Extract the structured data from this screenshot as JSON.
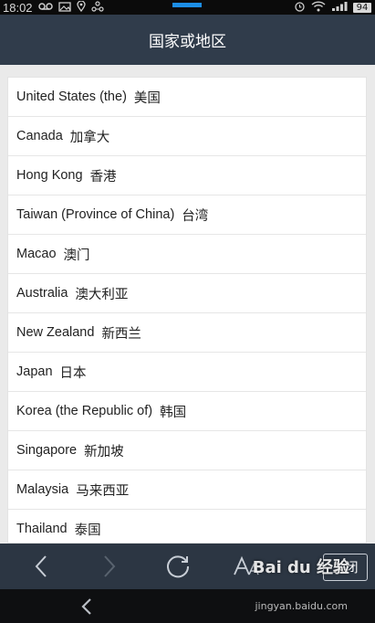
{
  "status_bar": {
    "time": "18:02",
    "battery": "94"
  },
  "title": "国家或地区",
  "countries": [
    {
      "en": "United States (the)",
      "cn": "美国"
    },
    {
      "en": "Canada",
      "cn": "加拿大"
    },
    {
      "en": "Hong Kong",
      "cn": "香港"
    },
    {
      "en": "Taiwan (Province of China)",
      "cn": "台湾"
    },
    {
      "en": "Macao",
      "cn": "澳门"
    },
    {
      "en": "Australia",
      "cn": "澳大利亚"
    },
    {
      "en": "New Zealand",
      "cn": "新西兰"
    },
    {
      "en": "Japan",
      "cn": "日本"
    },
    {
      "en": "Korea (the Republic of)",
      "cn": "韩国"
    },
    {
      "en": "Singapore",
      "cn": "新加坡"
    },
    {
      "en": "Malaysia",
      "cn": "马来西亚"
    },
    {
      "en": "Thailand",
      "cn": "泰国"
    }
  ],
  "toolbar": {
    "back_icon": "chevron-left-icon",
    "forward_icon": "chevron-right-icon",
    "refresh_icon": "refresh-icon",
    "font_icon": "font-size-icon",
    "close_label": "关闭"
  },
  "watermark": {
    "main": "Bai du 经验",
    "sub": "jingyan.baidu.com"
  },
  "colors": {
    "title_bar": "#303c4b",
    "toolbar": "#2c3643",
    "status_accent": "#1c8ee6"
  }
}
